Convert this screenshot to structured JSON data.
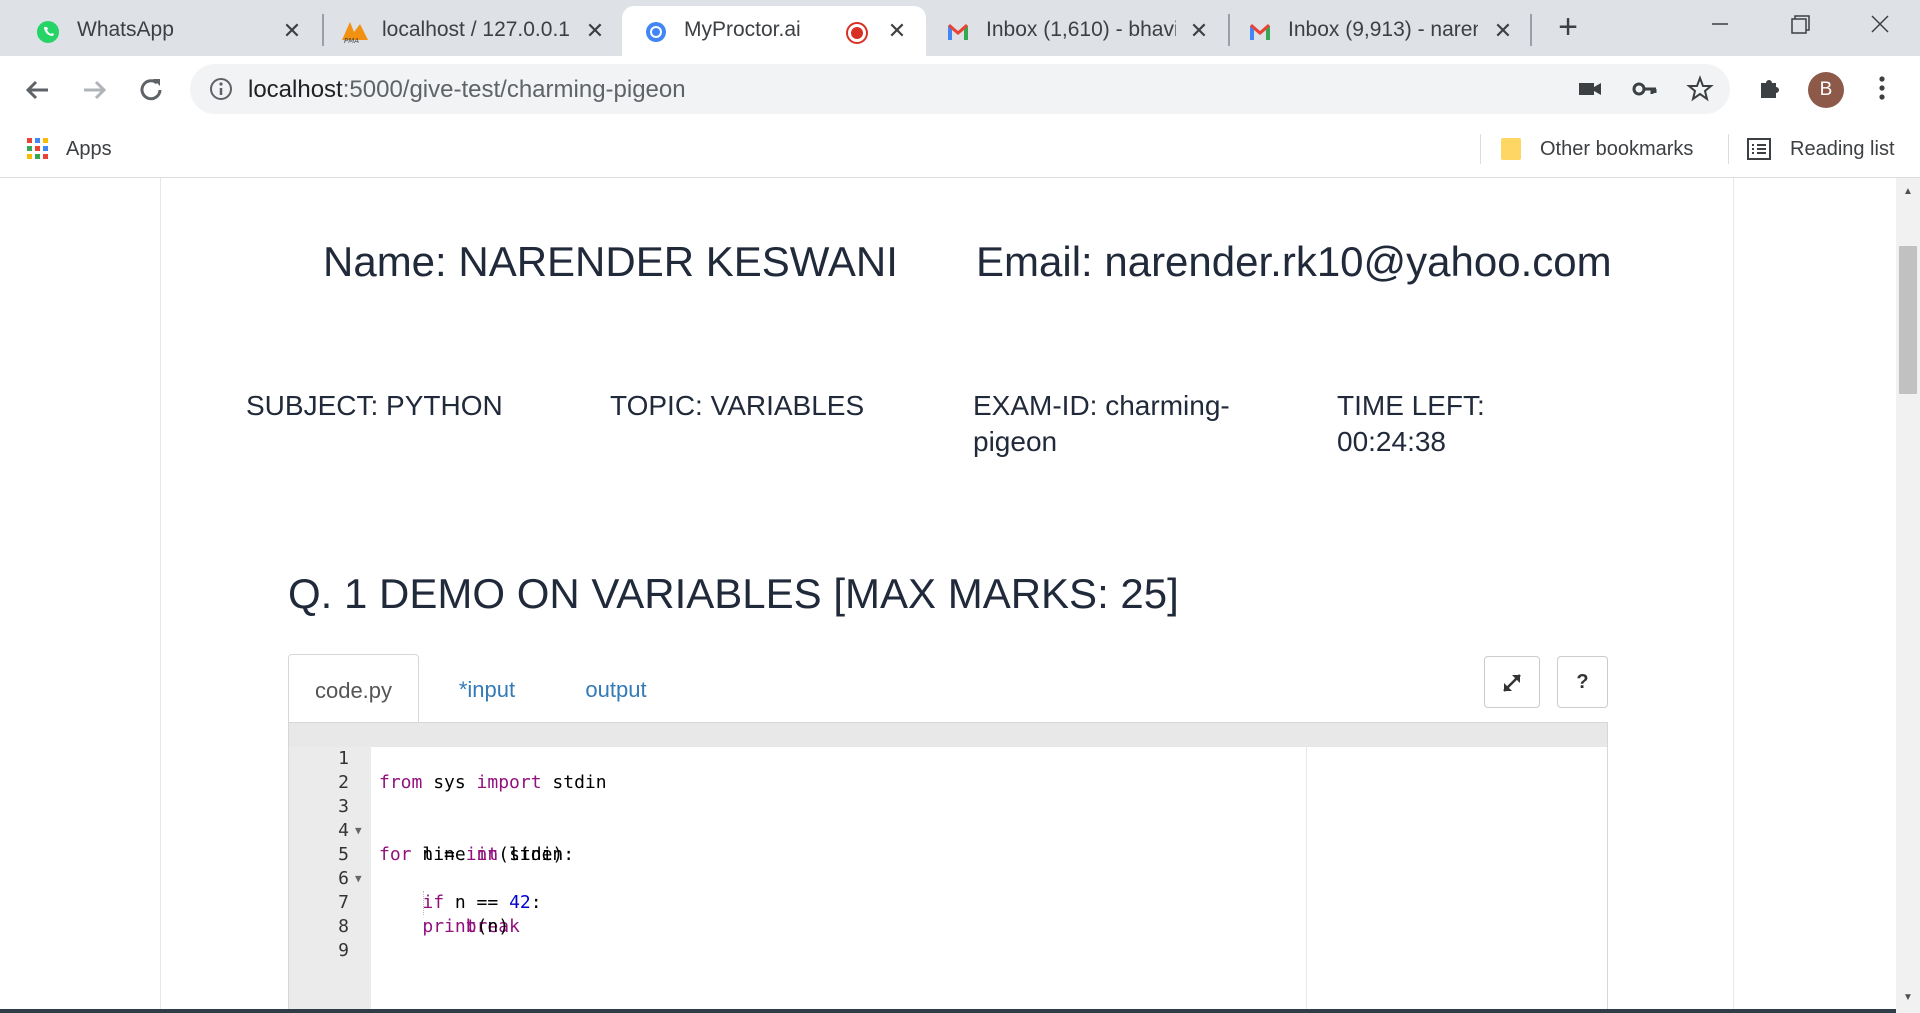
{
  "browser": {
    "tabs": [
      {
        "title": "WhatsApp",
        "icon": "whatsapp-icon",
        "active": false
      },
      {
        "title": "localhost / 127.0.0.1",
        "icon": "phpmyadmin-icon",
        "active": false
      },
      {
        "title": "MyProctor.ai",
        "icon": "chromium-icon",
        "active": true,
        "recording": true
      },
      {
        "title": "Inbox (1,610) - bhavi",
        "icon": "gmail-icon",
        "active": false
      },
      {
        "title": "Inbox (9,913) - naren",
        "icon": "gmail-icon",
        "active": false
      }
    ],
    "url_host": "localhost",
    "url_path": ":5000/give-test/charming-pigeon",
    "avatar_letter": "B",
    "bookmarks": {
      "apps": "Apps",
      "other": "Other bookmarks",
      "reading_list": "Reading list"
    }
  },
  "candidate": {
    "name_label": "Name: NARENDER KESWANI",
    "email_label": "Email: narender.rk10@yahoo.com"
  },
  "exam": {
    "subject": "SUBJECT: PYTHON",
    "topic": "TOPIC: VARIABLES",
    "exam_id": "EXAM-ID: charming-pigeon",
    "time_left_label": "TIME LEFT:",
    "time_left": "00:24:38"
  },
  "question": {
    "title": "Q. 1 DEMO ON VARIABLES [MAX MARKS: 25]"
  },
  "editor": {
    "tabs": [
      "code.py",
      "*input",
      "output"
    ],
    "expand_icon": "expand-icon",
    "help_label": "?",
    "line_numbers": [
      "1",
      "2",
      "3",
      "4",
      "5",
      "6",
      "7",
      "8",
      "9"
    ],
    "code": [
      "from sys import stdin",
      "",
      "for line in stdin:",
      "    n = int(line)",
      "    if n == 42:",
      "        break",
      "    print(n)",
      "",
      ""
    ]
  },
  "colors": {
    "tabstrip": "#dee1e6",
    "text_dark": "#212a3a",
    "link": "#337ab7",
    "keyword": "#93117e",
    "number": "#0000cd"
  }
}
